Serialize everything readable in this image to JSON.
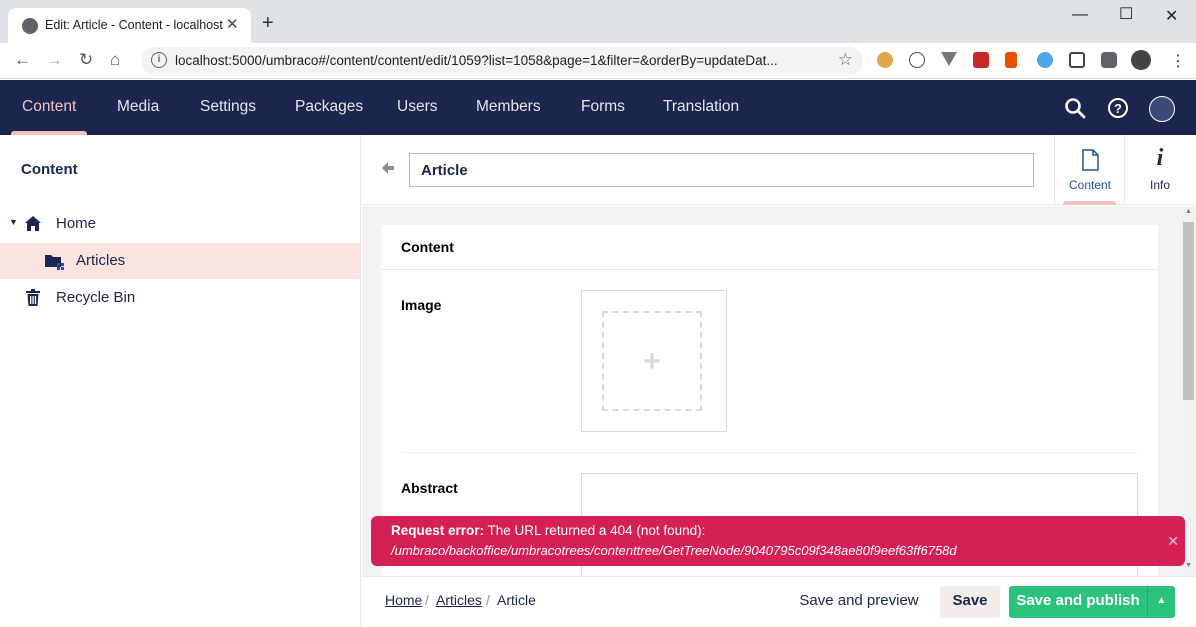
{
  "browser": {
    "tab_title": "Edit: Article - Content - localhost",
    "tab_close": "✕",
    "new_tab": "+",
    "url": "localhost:5000/umbraco#/content/content/edit/1059?list=1058&page=1&filter=&orderBy=updateDat..."
  },
  "header": {
    "sections": [
      "Content",
      "Media",
      "Settings",
      "Packages",
      "Users",
      "Members",
      "Forms",
      "Translation"
    ],
    "active_section": "Content"
  },
  "tree": {
    "title": "Content",
    "items": [
      {
        "label": "Home",
        "icon": "home-icon"
      },
      {
        "label": "Articles",
        "icon": "folder-icon",
        "selected": true
      },
      {
        "label": "Recycle Bin",
        "icon": "trash-icon"
      }
    ]
  },
  "editor": {
    "name_value": "Article",
    "apps": [
      {
        "label": "Content",
        "icon": "document-icon",
        "active": true
      },
      {
        "label": "Info",
        "icon": "info-icon"
      }
    ],
    "group_title": "Content",
    "properties": [
      {
        "label": "Image"
      },
      {
        "label": "Abstract"
      }
    ]
  },
  "notification": {
    "strong": "Request error:",
    "message": "The URL returned a 404 (not found):",
    "detail": "/umbraco/backoffice/umbracotrees/contenttree/GetTreeNode/9040795c09f348ae80f9eef63ff6758d",
    "close": "✕"
  },
  "footer": {
    "breadcrumb": [
      "Home",
      "Articles",
      "Article"
    ],
    "separator": "/",
    "save_preview": "Save and preview",
    "save": "Save",
    "save_publish": "Save and publish"
  },
  "colors": {
    "header_bg": "#1b264f",
    "active_accent": "#f5c1bc",
    "publish_green": "#2bc37c",
    "error_red": "#d42054"
  }
}
